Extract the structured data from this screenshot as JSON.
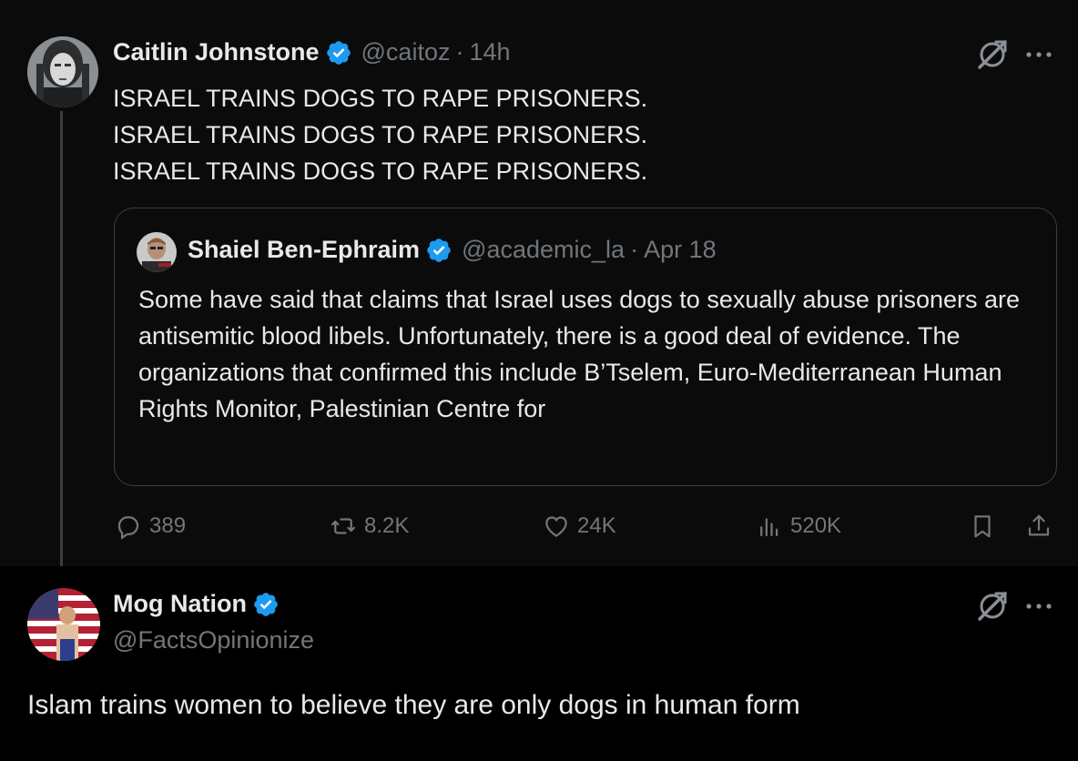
{
  "tweet": {
    "author_name": "Caitlin Johnstone",
    "handle": "@caitoz",
    "separator": "·",
    "time": "14h",
    "lines": [
      "ISRAEL TRAINS DOGS TO RAPE PRISONERS.",
      "ISRAEL TRAINS DOGS TO RAPE PRISONERS.",
      "ISRAEL TRAINS DOGS TO RAPE PRISONERS."
    ],
    "quote": {
      "author_name": "Shaiel Ben-Ephraim",
      "handle": "@academic_la",
      "separator": "·",
      "date": "Apr 18",
      "text": "Some have said that claims that Israel uses dogs to sexually abuse prisoners are antisemitic blood libels. Unfortunately, there is a good deal of evidence. The organizations that confirmed this include B’Tselem, Euro-Mediterranean Human Rights Monitor, Palestinian Centre for"
    },
    "stats": {
      "replies": "389",
      "reposts": "8.2K",
      "likes": "24K",
      "views": "520K"
    }
  },
  "reply": {
    "author_name": "Mog Nation",
    "handle": "@FactsOpinionize",
    "text": "Islam trains women to believe they are only dogs in human form"
  },
  "colors": {
    "verified": "#1d9bf0",
    "muted": "#71767b",
    "text": "#e7e9ea"
  },
  "icons": [
    "verified-badge-icon",
    "grok-icon",
    "more-icon",
    "reply-icon",
    "repost-icon",
    "like-icon",
    "views-icon",
    "bookmark-icon",
    "share-icon"
  ]
}
